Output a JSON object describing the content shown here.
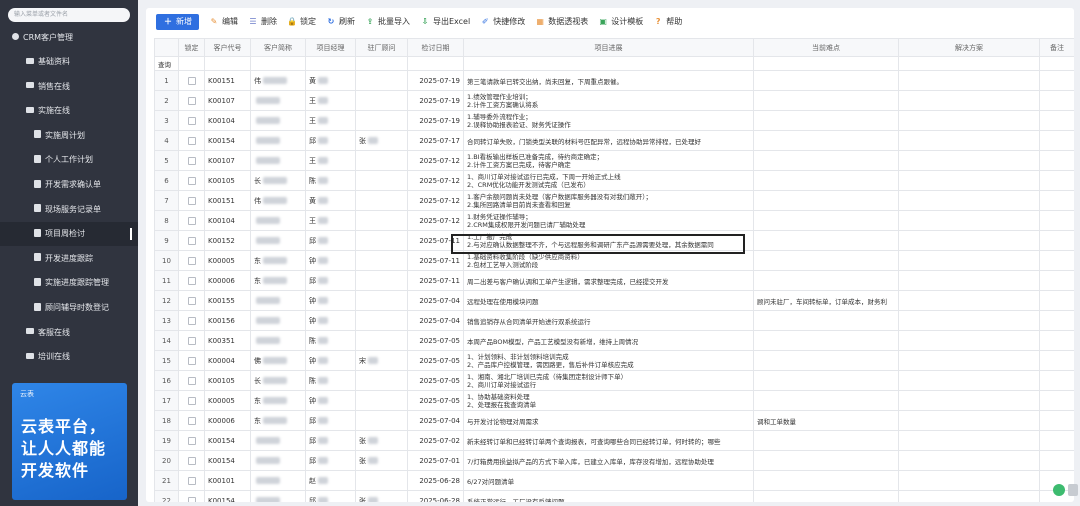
{
  "sidebar": {
    "search_placeholder": "输入菜单或者文件名",
    "root": "CRM客户管理",
    "items": [
      {
        "label": "基础资料",
        "icon": "folder-icon"
      },
      {
        "label": "销售在线",
        "icon": "folder-icon"
      },
      {
        "label": "实施在线",
        "icon": "folder-icon"
      },
      {
        "label": "实施周计划",
        "icon": "doc-icon"
      },
      {
        "label": "个人工作计划",
        "icon": "doc-icon"
      },
      {
        "label": "开发需求确认单",
        "icon": "doc-icon"
      },
      {
        "label": "现场服务记录单",
        "icon": "doc-icon"
      },
      {
        "label": "项目周检讨",
        "icon": "doc-icon"
      },
      {
        "label": "开发进度跟踪",
        "icon": "doc-icon"
      },
      {
        "label": "实施进度跟踪管理",
        "icon": "doc-icon"
      },
      {
        "label": "顾问辅导时数登记",
        "icon": "doc-icon"
      },
      {
        "label": "客服在线",
        "icon": "folder-icon"
      },
      {
        "label": "培训在线",
        "icon": "folder-icon"
      }
    ],
    "banner": {
      "logo": "云表",
      "line1": "云表平台，",
      "line2": "让人人都能",
      "line3": "开发软件"
    }
  },
  "toolbar": {
    "buttons": [
      "新增",
      "编辑",
      "删除",
      "锁定",
      "刷新",
      "批量导入",
      "导出Excel",
      "快捷修改",
      "数据透视表",
      "设计模板",
      "帮助"
    ]
  },
  "grid": {
    "headers": [
      "",
      "锁定",
      "客户代号",
      "客户简称",
      "项目经理",
      "驻厂顾问",
      "检讨日期",
      "项目进展",
      "当前难点",
      "解决方案",
      "备注"
    ],
    "filter_label": "查询",
    "rows": [
      {
        "n": "1",
        "code": "K00151",
        "name": "伟",
        "pm": "黄",
        "gw": "",
        "date": "2025-07-19",
        "p": [
          "第三笔请款单已转交出纳，尚未回复，下周重点跟催。"
        ],
        "d": ""
      },
      {
        "n": "2",
        "code": "K00107",
        "name": "",
        "pm": "王",
        "gw": "",
        "date": "2025-07-19",
        "p": [
          "1.绩效管理作业培训；",
          "2.计件工资方案确认将系"
        ],
        "d": ""
      },
      {
        "n": "3",
        "code": "K00104",
        "name": "",
        "pm": "王",
        "gw": "",
        "date": "2025-07-19",
        "p": [
          "1.辅导委外流程作业；",
          "2.误释协助报表验证、财务凭证操作"
        ],
        "d": ""
      },
      {
        "n": "4",
        "code": "K00154",
        "name": "",
        "pm": "邱",
        "gw": "张",
        "date": "2025-07-17",
        "p": [
          "合同转订单失败，门锁类型关联的材料号匹配异常，远程协助异常排程，已处理好"
        ],
        "d": ""
      },
      {
        "n": "5",
        "code": "K00107",
        "name": "",
        "pm": "王",
        "gw": "",
        "date": "2025-07-12",
        "p": [
          "1.BI看板输出样板已准备完成，待约商定确定；",
          "2.计件工资方案已完成，待客户确定"
        ],
        "d": ""
      },
      {
        "n": "6",
        "code": "K00105",
        "name": "长",
        "pm": "陈",
        "gw": "",
        "date": "2025-07-12",
        "p": [
          "1、商川订单对接试运行已完成，下周一开始正式上线",
          "2、CRM优化功能开发测试完成（已发布）"
        ],
        "d": ""
      },
      {
        "n": "7",
        "code": "K00151",
        "name": "伟",
        "pm": "黄",
        "gw": "",
        "date": "2025-07-12",
        "p": [
          "1.客户余额问题尚未处理（客户数据库服务器没有对我们敞开）；",
          "2.集所回路清单目前尚未查看和回复"
        ],
        "d": ""
      },
      {
        "n": "8",
        "code": "K00104",
        "name": "",
        "pm": "王",
        "gw": "",
        "date": "2025-07-12",
        "p": [
          "1.财务凭证操作辅导；",
          "2.CRM集成权限开发问题已请厂辅助处理"
        ],
        "d": ""
      },
      {
        "n": "9",
        "code": "K00152",
        "name": "",
        "pm": "邱",
        "gw": "",
        "date": "2025-07-11",
        "p": [
          "1.工厂搬厂完成",
          "2.与对应确认数据整理不齐，个与远程服务和调研广东产品源需要处理，其余数据需同"
        ],
        "d": ""
      },
      {
        "n": "10",
        "code": "K00005",
        "name": "东",
        "pm": "钟",
        "gw": "",
        "date": "2025-07-11",
        "p": [
          "1.基础资料收集阶段（缺少供应商资料）",
          "2.包材工艺导入测试阶段"
        ],
        "d": ""
      },
      {
        "n": "11",
        "code": "K00006",
        "name": "东",
        "pm": "邱",
        "gw": "",
        "date": "2025-07-11",
        "p": [
          "周二出差与客户确认调和工单产生逻辑，需求整理完成，已经提交开发"
        ],
        "d": ""
      },
      {
        "n": "12",
        "code": "K00155",
        "name": "",
        "pm": "钟",
        "gw": "",
        "date": "2025-07-04",
        "p": [
          "远程处理在使用模块问题"
        ],
        "d": "顾问未驻厂，车间转标单，订单成本，财务利"
      },
      {
        "n": "13",
        "code": "K00156",
        "name": "",
        "pm": "钟",
        "gw": "",
        "date": "2025-07-04",
        "p": [
          "销售追销存从合同清单开始进行双系统运行"
        ],
        "d": ""
      },
      {
        "n": "14",
        "code": "K00351",
        "name": "",
        "pm": "陈",
        "gw": "",
        "date": "2025-07-05",
        "p": [
          "本周产品BOM模型，产品工艺模型没有新增，维持上周情况"
        ],
        "d": ""
      },
      {
        "n": "15",
        "code": "K00004",
        "name": "佛",
        "pm": "钟",
        "gw": "宋",
        "date": "2025-07-05",
        "p": [
          "1、计划领料、非计划领料培训完成",
          "2、产品库户控模管理，需因路更，售后补件订单核应完成"
        ],
        "d": ""
      },
      {
        "n": "16",
        "code": "K00105",
        "name": "长",
        "pm": "陈",
        "gw": "",
        "date": "2025-07-05",
        "p": [
          "1、湘南、湘北厂培训已完成（待集团定制设计师下单）",
          "2、商川订单对接试运行"
        ],
        "d": ""
      },
      {
        "n": "17",
        "code": "K00005",
        "name": "东",
        "pm": "钟",
        "gw": "",
        "date": "2025-07-05",
        "p": [
          "1、协助基础资料处理",
          "2、处理报在我查询清单"
        ],
        "d": ""
      },
      {
        "n": "18",
        "code": "K00006",
        "name": "东",
        "pm": "邱",
        "gw": "",
        "date": "2025-07-04",
        "p": [
          "与开发讨论物理对周需求"
        ],
        "d": "调和工单数量"
      },
      {
        "n": "19",
        "code": "K00154",
        "name": "",
        "pm": "邱",
        "gw": "张",
        "date": "2025-07-02",
        "p": [
          "新未经转订单和已经转订单两个查询报表，可查询哪些合同已经转订单，何时转的；哪些"
        ],
        "d": ""
      },
      {
        "n": "20",
        "code": "K00154",
        "name": "",
        "pm": "邱",
        "gw": "张",
        "date": "2025-07-01",
        "p": [
          "7/灯箱费用损益拟产品的方式下单入库，已建立入库单，库存没有增加，远程协助处理"
        ],
        "d": ""
      },
      {
        "n": "21",
        "code": "K00101",
        "name": "",
        "pm": "赵",
        "gw": "",
        "date": "2025-06-28",
        "p": [
          "6/27对问题清单"
        ],
        "d": ""
      },
      {
        "n": "22",
        "code": "K00154",
        "name": "",
        "pm": "邱",
        "gw": "张",
        "date": "2025-06-28",
        "p": [
          "系统正常运行，工厂没有反馈问题"
        ],
        "d": ""
      }
    ]
  }
}
